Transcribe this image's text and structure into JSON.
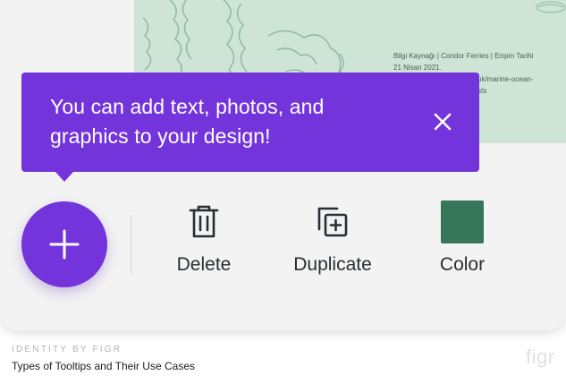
{
  "document": {
    "citation_line1": "Bilgi Kaynağı | Condor Ferries | Erişim Tarihi",
    "citation_line2": "21 Nisan 2021.",
    "citation_line3": "uk/marine-ocean-",
    "citation_line4": "sts"
  },
  "tooltip": {
    "line1": "You can add text, photos, and",
    "line2": "graphics to your design!",
    "close_icon": "close-icon"
  },
  "toolbar": {
    "add_icon": "plus-icon",
    "actions": [
      {
        "label": "Delete",
        "icon": "trash-icon"
      },
      {
        "label": "Duplicate",
        "icon": "duplicate-icon"
      },
      {
        "label": "Color",
        "icon": "color-swatch",
        "color": "#36765a"
      }
    ]
  },
  "colors": {
    "accent": "#7434db",
    "doc_background": "#cde4d6"
  },
  "footer": {
    "brand": "IDENTITY BY FIGR",
    "caption": "Types of Tooltips and Their Use Cases",
    "watermark": "figr"
  }
}
